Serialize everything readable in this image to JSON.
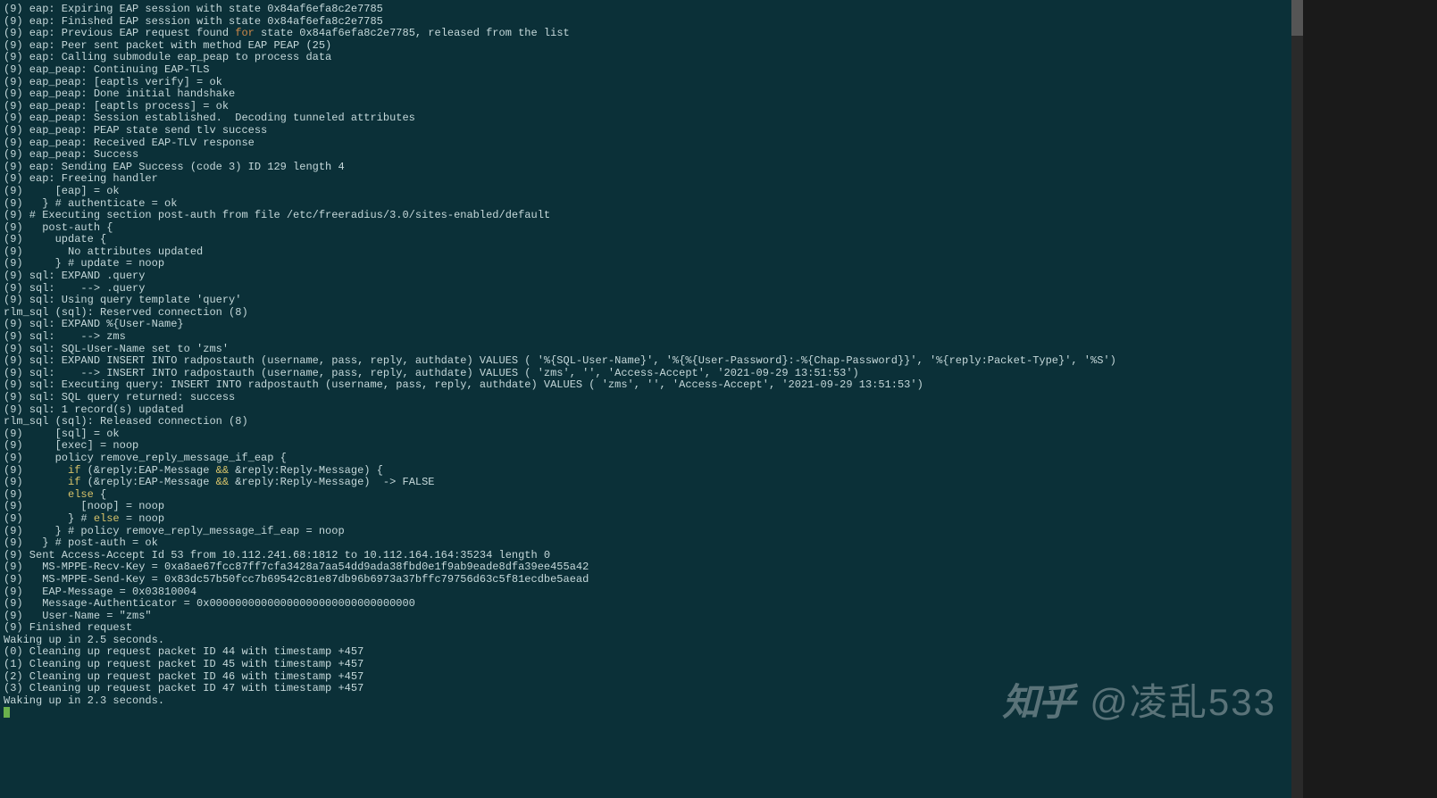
{
  "lines": [
    {
      "segments": [
        {
          "t": "(9) eap: Expiring EAP session with state 0x84af6efa8c2e7785"
        }
      ]
    },
    {
      "segments": [
        {
          "t": "(9) eap: Finished EAP session with state 0x84af6efa8c2e7785"
        }
      ]
    },
    {
      "segments": [
        {
          "t": "(9) eap: Previous EAP request found "
        },
        {
          "t": "for",
          "c": "kw-orange"
        },
        {
          "t": " state 0x84af6efa8c2e7785, released from the list"
        }
      ]
    },
    {
      "segments": [
        {
          "t": "(9) eap: Peer sent packet with method EAP PEAP (25)"
        }
      ]
    },
    {
      "segments": [
        {
          "t": "(9) eap: Calling submodule eap_peap to process data"
        }
      ]
    },
    {
      "segments": [
        {
          "t": "(9) eap_peap: Continuing EAP-TLS"
        }
      ]
    },
    {
      "segments": [
        {
          "t": "(9) eap_peap: [eaptls verify] = ok"
        }
      ]
    },
    {
      "segments": [
        {
          "t": "(9) eap_peap: Done initial handshake"
        }
      ]
    },
    {
      "segments": [
        {
          "t": "(9) eap_peap: [eaptls process] = ok"
        }
      ]
    },
    {
      "segments": [
        {
          "t": "(9) eap_peap: Session established.  Decoding tunneled attributes"
        }
      ]
    },
    {
      "segments": [
        {
          "t": "(9) eap_peap: PEAP state send tlv success"
        }
      ]
    },
    {
      "segments": [
        {
          "t": "(9) eap_peap: Received EAP-TLV response"
        }
      ]
    },
    {
      "segments": [
        {
          "t": "(9) eap_peap: Success"
        }
      ]
    },
    {
      "segments": [
        {
          "t": "(9) eap: Sending EAP Success (code 3) ID 129 length 4"
        }
      ]
    },
    {
      "segments": [
        {
          "t": "(9) eap: Freeing handler"
        }
      ]
    },
    {
      "segments": [
        {
          "t": "(9)     [eap] = ok"
        }
      ]
    },
    {
      "segments": [
        {
          "t": "(9)   } # authenticate = ok"
        }
      ]
    },
    {
      "segments": [
        {
          "t": "(9) # Executing section post-auth from file /etc/freeradius/3.0/sites-enabled/default"
        }
      ]
    },
    {
      "segments": [
        {
          "t": "(9)   post-auth {"
        }
      ]
    },
    {
      "segments": [
        {
          "t": "(9)     update {"
        }
      ]
    },
    {
      "segments": [
        {
          "t": "(9)       No attributes updated"
        }
      ]
    },
    {
      "segments": [
        {
          "t": "(9)     } # update = noop"
        }
      ]
    },
    {
      "segments": [
        {
          "t": "(9) sql: EXPAND .query"
        }
      ]
    },
    {
      "segments": [
        {
          "t": "(9) sql:    --> .query"
        }
      ]
    },
    {
      "segments": [
        {
          "t": "(9) sql: Using query template 'query'"
        }
      ]
    },
    {
      "segments": [
        {
          "t": "rlm_sql (sql): Reserved connection (8)"
        }
      ]
    },
    {
      "segments": [
        {
          "t": "(9) sql: EXPAND %{User-Name}"
        }
      ]
    },
    {
      "segments": [
        {
          "t": "(9) sql:    --> zms"
        }
      ]
    },
    {
      "segments": [
        {
          "t": "(9) sql: SQL-User-Name set to 'zms'"
        }
      ]
    },
    {
      "segments": [
        {
          "t": "(9) sql: EXPAND INSERT INTO radpostauth (username, pass, reply, authdate) VALUES ( '%{SQL-User-Name}', '%{%{User-Password}:-%{Chap-Password}}', '%{reply:Packet-Type}', '%S')"
        }
      ]
    },
    {
      "segments": [
        {
          "t": "(9) sql:    --> INSERT INTO radpostauth (username, pass, reply, authdate) VALUES ( 'zms', '', 'Access-Accept', '2021-09-29 13:51:53')"
        }
      ]
    },
    {
      "segments": [
        {
          "t": "(9) sql: Executing query: INSERT INTO radpostauth (username, pass, reply, authdate) VALUES ( 'zms', '', 'Access-Accept', '2021-09-29 13:51:53')"
        }
      ]
    },
    {
      "segments": [
        {
          "t": "(9) sql: SQL query returned: success"
        }
      ]
    },
    {
      "segments": [
        {
          "t": "(9) sql: 1 record(s) updated"
        }
      ]
    },
    {
      "segments": [
        {
          "t": "rlm_sql (sql): Released connection (8)"
        }
      ]
    },
    {
      "segments": [
        {
          "t": "(9)     [sql] = ok"
        }
      ]
    },
    {
      "segments": [
        {
          "t": "(9)     [exec] = noop"
        }
      ]
    },
    {
      "segments": [
        {
          "t": "(9)     policy remove_reply_message_if_eap {"
        }
      ]
    },
    {
      "segments": [
        {
          "t": "(9)       "
        },
        {
          "t": "if",
          "c": "kw-yellow"
        },
        {
          "t": " (&reply:EAP-Message "
        },
        {
          "t": "&&",
          "c": "kw-yellow"
        },
        {
          "t": " &reply:Reply-Message) {"
        }
      ]
    },
    {
      "segments": [
        {
          "t": "(9)       "
        },
        {
          "t": "if",
          "c": "kw-yellow"
        },
        {
          "t": " (&reply:EAP-Message "
        },
        {
          "t": "&&",
          "c": "kw-yellow"
        },
        {
          "t": " &reply:Reply-Message)  -> FALSE"
        }
      ]
    },
    {
      "segments": [
        {
          "t": "(9)       "
        },
        {
          "t": "else",
          "c": "kw-yellow"
        },
        {
          "t": " {"
        }
      ]
    },
    {
      "segments": [
        {
          "t": "(9)         [noop] = noop"
        }
      ]
    },
    {
      "segments": [
        {
          "t": "(9)       } # "
        },
        {
          "t": "else",
          "c": "kw-yellow"
        },
        {
          "t": " = noop"
        }
      ]
    },
    {
      "segments": [
        {
          "t": "(9)     } # policy remove_reply_message_if_eap = noop"
        }
      ]
    },
    {
      "segments": [
        {
          "t": "(9)   } # post-auth = ok"
        }
      ]
    },
    {
      "segments": [
        {
          "t": "(9) Sent Access-Accept Id 53 from 10.112.241.68:1812 to 10.112.164.164:35234 length 0"
        }
      ]
    },
    {
      "segments": [
        {
          "t": "(9)   MS-MPPE-Recv-Key = 0xa8ae67fcc87ff7cfa3428a7aa54dd9ada38fbd0e1f9ab9eade8dfa39ee455a42"
        }
      ]
    },
    {
      "segments": [
        {
          "t": "(9)   MS-MPPE-Send-Key = 0x83dc57b50fcc7b69542c81e87db96b6973a37bffc79756d63c5f81ecdbe5aead"
        }
      ]
    },
    {
      "segments": [
        {
          "t": "(9)   EAP-Message = 0x03810004"
        }
      ]
    },
    {
      "segments": [
        {
          "t": "(9)   Message-Authenticator = 0x00000000000000000000000000000000"
        }
      ]
    },
    {
      "segments": [
        {
          "t": "(9)   User-Name = \"zms\""
        }
      ]
    },
    {
      "segments": [
        {
          "t": "(9) Finished request"
        }
      ]
    },
    {
      "segments": [
        {
          "t": "Waking up in 2.5 seconds."
        }
      ]
    },
    {
      "segments": [
        {
          "t": "(0) Cleaning up request packet ID 44 with timestamp +457"
        }
      ]
    },
    {
      "segments": [
        {
          "t": "(1) Cleaning up request packet ID 45 with timestamp +457"
        }
      ]
    },
    {
      "segments": [
        {
          "t": "(2) Cleaning up request packet ID 46 with timestamp +457"
        }
      ]
    },
    {
      "segments": [
        {
          "t": "(3) Cleaning up request packet ID 47 with timestamp +457"
        }
      ]
    },
    {
      "segments": [
        {
          "t": "Waking up in 2.3 seconds."
        }
      ]
    }
  ],
  "watermark": {
    "logo": "知乎",
    "text": "@凌乱533"
  }
}
